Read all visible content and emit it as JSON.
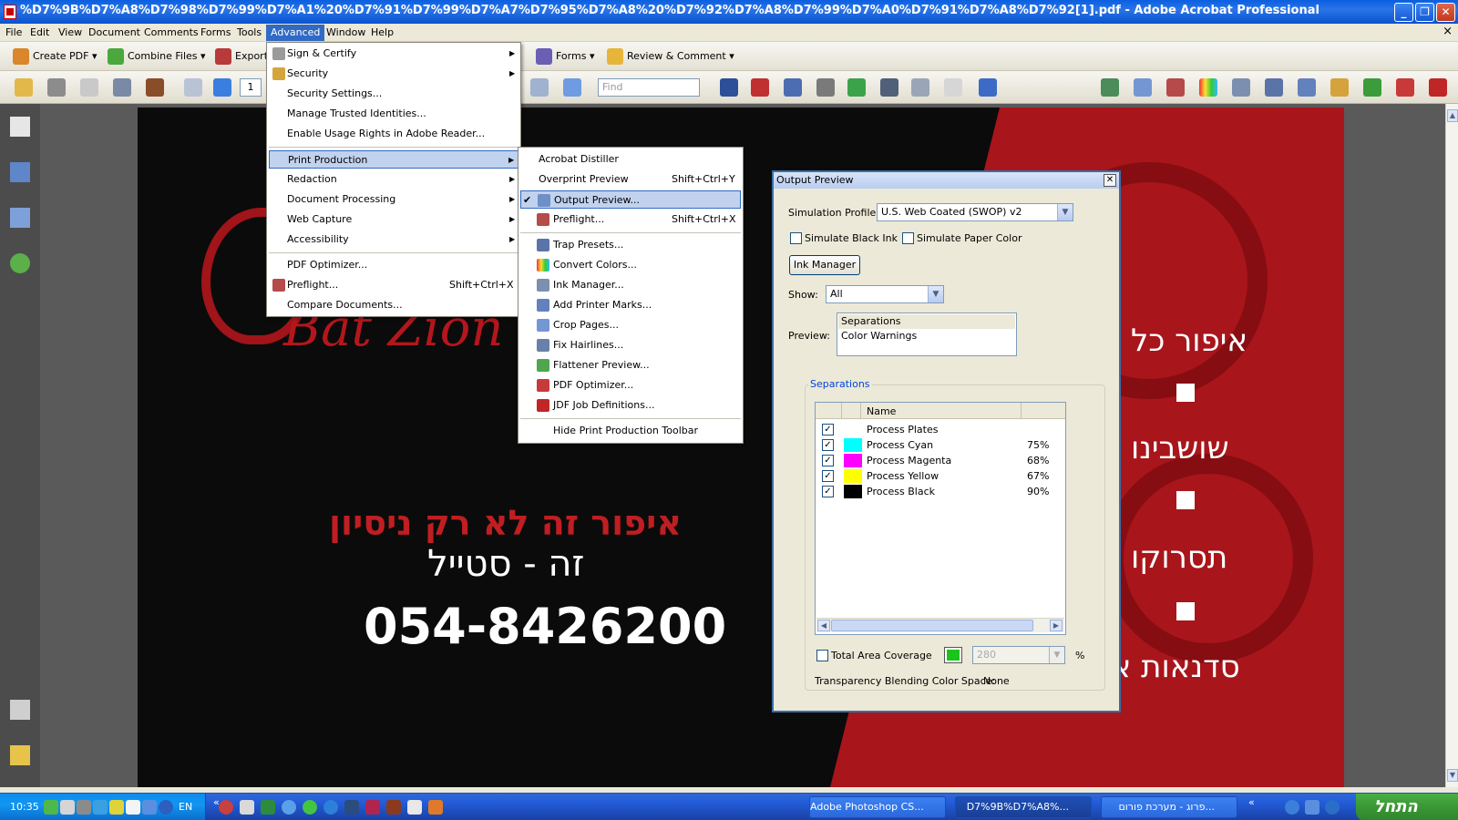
{
  "window": {
    "title": "%D7%9B%D7%A8%D7%98%D7%99%D7%A1%20%D7%91%D7%99%D7%A7%D7%95%D7%A8%20%D7%92%D7%A8%D7%99%D7%A0%D7%91%D7%A8%D7%92[1].pdf - Adobe Acrobat Professional",
    "minimize": "_",
    "restore": "❐",
    "close": "✕"
  },
  "menubar": {
    "items": [
      "File",
      "Edit",
      "View",
      "Document",
      "Comments",
      "Forms",
      "Tools",
      "Advanced",
      "Window",
      "Help"
    ],
    "doc_close": "×"
  },
  "toolbar": {
    "create_pdf": "Create PDF",
    "combine_files": "Combine Files",
    "export": "Export",
    "forms": "Forms",
    "review_comment": "Review & Comment",
    "page_number": "1",
    "find_placeholder": "Find"
  },
  "advanced_menu": {
    "items": [
      {
        "label": "Sign & Certify",
        "submenu": true
      },
      {
        "label": "Security",
        "submenu": true
      },
      {
        "label": "Security Settings..."
      },
      {
        "label": "Manage Trusted Identities..."
      },
      {
        "label": "Enable Usage Rights in Adobe Reader..."
      },
      {
        "label": "Print Production",
        "submenu": true
      },
      {
        "label": "Redaction",
        "submenu": true
      },
      {
        "label": "Document Processing",
        "submenu": true
      },
      {
        "label": "Web Capture",
        "submenu": true
      },
      {
        "label": "Accessibility",
        "submenu": true
      },
      {
        "label": "PDF Optimizer..."
      },
      {
        "label": "Preflight...",
        "shortcut": "Shift+Ctrl+X"
      },
      {
        "label": "Compare Documents..."
      }
    ]
  },
  "print_production_menu": {
    "items": [
      {
        "label": "Acrobat Distiller"
      },
      {
        "label": "Overprint Preview",
        "shortcut": "Shift+Ctrl+Y"
      },
      {
        "label": "Output Preview..."
      },
      {
        "label": "Preflight...",
        "shortcut": "Shift+Ctrl+X"
      },
      {
        "label": "Trap Presets..."
      },
      {
        "label": "Convert Colors..."
      },
      {
        "label": "Ink Manager..."
      },
      {
        "label": "Add Printer Marks..."
      },
      {
        "label": "Crop Pages..."
      },
      {
        "label": "Fix Hairlines..."
      },
      {
        "label": "Flattener Preview..."
      },
      {
        "label": "PDF Optimizer..."
      },
      {
        "label": "JDF Job Definitions..."
      },
      {
        "label": "Hide Print Production Toolbar"
      }
    ]
  },
  "output_preview": {
    "title": "Output Preview",
    "simulation_profile_label": "Simulation Profile:",
    "simulation_profile_value": "U.S. Web Coated (SWOP) v2",
    "simulate_black_ink": "Simulate Black Ink",
    "simulate_paper_color": "Simulate Paper Color",
    "ink_manager": "Ink Manager",
    "show_label": "Show:",
    "show_value": "All",
    "preview_label": "Preview:",
    "preview_options": [
      "Separations",
      "Color Warnings"
    ],
    "separations_title": "Separations",
    "name_header": "Name",
    "rows": [
      {
        "name": "Process Plates",
        "value": "",
        "color": ""
      },
      {
        "name": "Process Cyan",
        "value": "75%",
        "color": "#00ffff"
      },
      {
        "name": "Process Magenta",
        "value": "68%",
        "color": "#ff00ff"
      },
      {
        "name": "Process Yellow",
        "value": "67%",
        "color": "#ffff00"
      },
      {
        "name": "Process Black",
        "value": "90%",
        "color": "#000000"
      }
    ],
    "total_area_coverage": "Total Area Coverage",
    "tac_value": "280",
    "percent": "%",
    "transparency_label": "Transparency Blending Color Space:",
    "transparency_value": "None"
  },
  "document": {
    "lines": {
      "hebrew_red": "איפור זה לא רק ניסיון",
      "hebrew_white": "זה - סטייל",
      "phone": "054-8426200",
      "bat_zion": "Bat Zion",
      "right1": "איפור כל",
      "right2": "שושבינו",
      "right3": "תסרוקו",
      "right4": "סדנאות אי"
    }
  },
  "taskbar": {
    "clock": "10:35",
    "lang": "EN",
    "tasks": [
      "Adobe Photoshop CS...",
      "D7%9B%D7%A8%...",
      "פרוג - מערכת פורום..."
    ],
    "start": "התחל"
  }
}
